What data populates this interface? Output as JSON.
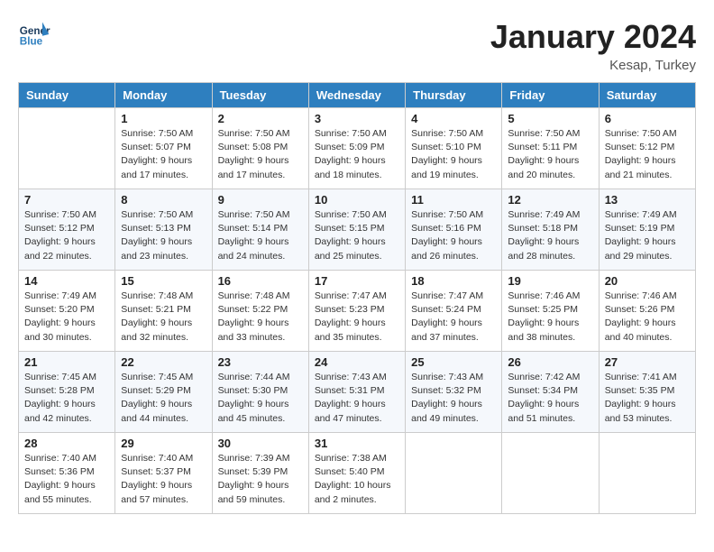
{
  "header": {
    "logo_general": "General",
    "logo_blue": "Blue",
    "month_title": "January 2024",
    "location": "Kesap, Turkey"
  },
  "days_of_week": [
    "Sunday",
    "Monday",
    "Tuesday",
    "Wednesday",
    "Thursday",
    "Friday",
    "Saturday"
  ],
  "weeks": [
    [
      {
        "day": "",
        "info": ""
      },
      {
        "day": "1",
        "info": "Sunrise: 7:50 AM\nSunset: 5:07 PM\nDaylight: 9 hours\nand 17 minutes."
      },
      {
        "day": "2",
        "info": "Sunrise: 7:50 AM\nSunset: 5:08 PM\nDaylight: 9 hours\nand 17 minutes."
      },
      {
        "day": "3",
        "info": "Sunrise: 7:50 AM\nSunset: 5:09 PM\nDaylight: 9 hours\nand 18 minutes."
      },
      {
        "day": "4",
        "info": "Sunrise: 7:50 AM\nSunset: 5:10 PM\nDaylight: 9 hours\nand 19 minutes."
      },
      {
        "day": "5",
        "info": "Sunrise: 7:50 AM\nSunset: 5:11 PM\nDaylight: 9 hours\nand 20 minutes."
      },
      {
        "day": "6",
        "info": "Sunrise: 7:50 AM\nSunset: 5:12 PM\nDaylight: 9 hours\nand 21 minutes."
      }
    ],
    [
      {
        "day": "7",
        "info": "Sunrise: 7:50 AM\nSunset: 5:12 PM\nDaylight: 9 hours\nand 22 minutes."
      },
      {
        "day": "8",
        "info": "Sunrise: 7:50 AM\nSunset: 5:13 PM\nDaylight: 9 hours\nand 23 minutes."
      },
      {
        "day": "9",
        "info": "Sunrise: 7:50 AM\nSunset: 5:14 PM\nDaylight: 9 hours\nand 24 minutes."
      },
      {
        "day": "10",
        "info": "Sunrise: 7:50 AM\nSunset: 5:15 PM\nDaylight: 9 hours\nand 25 minutes."
      },
      {
        "day": "11",
        "info": "Sunrise: 7:50 AM\nSunset: 5:16 PM\nDaylight: 9 hours\nand 26 minutes."
      },
      {
        "day": "12",
        "info": "Sunrise: 7:49 AM\nSunset: 5:18 PM\nDaylight: 9 hours\nand 28 minutes."
      },
      {
        "day": "13",
        "info": "Sunrise: 7:49 AM\nSunset: 5:19 PM\nDaylight: 9 hours\nand 29 minutes."
      }
    ],
    [
      {
        "day": "14",
        "info": "Sunrise: 7:49 AM\nSunset: 5:20 PM\nDaylight: 9 hours\nand 30 minutes."
      },
      {
        "day": "15",
        "info": "Sunrise: 7:48 AM\nSunset: 5:21 PM\nDaylight: 9 hours\nand 32 minutes."
      },
      {
        "day": "16",
        "info": "Sunrise: 7:48 AM\nSunset: 5:22 PM\nDaylight: 9 hours\nand 33 minutes."
      },
      {
        "day": "17",
        "info": "Sunrise: 7:47 AM\nSunset: 5:23 PM\nDaylight: 9 hours\nand 35 minutes."
      },
      {
        "day": "18",
        "info": "Sunrise: 7:47 AM\nSunset: 5:24 PM\nDaylight: 9 hours\nand 37 minutes."
      },
      {
        "day": "19",
        "info": "Sunrise: 7:46 AM\nSunset: 5:25 PM\nDaylight: 9 hours\nand 38 minutes."
      },
      {
        "day": "20",
        "info": "Sunrise: 7:46 AM\nSunset: 5:26 PM\nDaylight: 9 hours\nand 40 minutes."
      }
    ],
    [
      {
        "day": "21",
        "info": "Sunrise: 7:45 AM\nSunset: 5:28 PM\nDaylight: 9 hours\nand 42 minutes."
      },
      {
        "day": "22",
        "info": "Sunrise: 7:45 AM\nSunset: 5:29 PM\nDaylight: 9 hours\nand 44 minutes."
      },
      {
        "day": "23",
        "info": "Sunrise: 7:44 AM\nSunset: 5:30 PM\nDaylight: 9 hours\nand 45 minutes."
      },
      {
        "day": "24",
        "info": "Sunrise: 7:43 AM\nSunset: 5:31 PM\nDaylight: 9 hours\nand 47 minutes."
      },
      {
        "day": "25",
        "info": "Sunrise: 7:43 AM\nSunset: 5:32 PM\nDaylight: 9 hours\nand 49 minutes."
      },
      {
        "day": "26",
        "info": "Sunrise: 7:42 AM\nSunset: 5:34 PM\nDaylight: 9 hours\nand 51 minutes."
      },
      {
        "day": "27",
        "info": "Sunrise: 7:41 AM\nSunset: 5:35 PM\nDaylight: 9 hours\nand 53 minutes."
      }
    ],
    [
      {
        "day": "28",
        "info": "Sunrise: 7:40 AM\nSunset: 5:36 PM\nDaylight: 9 hours\nand 55 minutes."
      },
      {
        "day": "29",
        "info": "Sunrise: 7:40 AM\nSunset: 5:37 PM\nDaylight: 9 hours\nand 57 minutes."
      },
      {
        "day": "30",
        "info": "Sunrise: 7:39 AM\nSunset: 5:39 PM\nDaylight: 9 hours\nand 59 minutes."
      },
      {
        "day": "31",
        "info": "Sunrise: 7:38 AM\nSunset: 5:40 PM\nDaylight: 10 hours\nand 2 minutes."
      },
      {
        "day": "",
        "info": ""
      },
      {
        "day": "",
        "info": ""
      },
      {
        "day": "",
        "info": ""
      }
    ]
  ]
}
